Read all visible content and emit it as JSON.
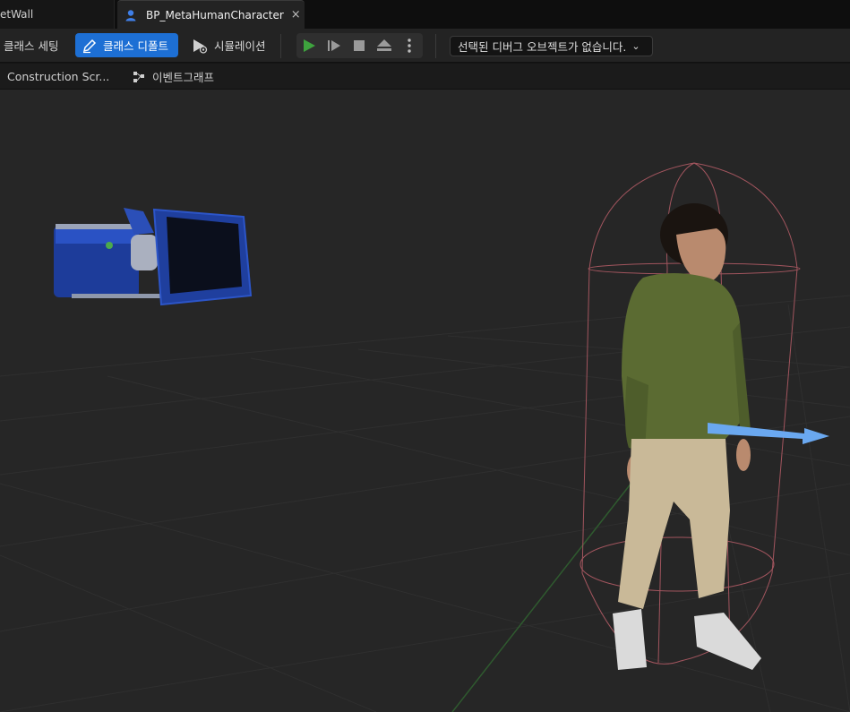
{
  "tabs": {
    "previous": "etWall",
    "active": "BP_MetaHumanCharacter",
    "close_glyph": "×"
  },
  "toolbar": {
    "class_settings": "클래스 세팅",
    "class_defaults": "클래스 디폴트",
    "simulation": "시뮬레이션",
    "debug_object": "선택된 디버그 오브젝트가 없습니다.",
    "debug_chevron": "⌄"
  },
  "graph_tabs": {
    "construction": "Construction Scr...",
    "event_graph": "이벤트그래프"
  },
  "icons": {
    "tab": "character-icon",
    "class_defaults": "edit-pencil-icon",
    "simulation": "simulation-play-icon",
    "play": "play-icon",
    "step": "advance-frame-icon",
    "stop": "stop-icon",
    "eject": "eject-icon",
    "more": "more-vertical-icon",
    "event_graph": "graph-nodes-icon"
  },
  "colors": {
    "accent_blue": "#1d6fd4",
    "play_green": "#3ea33e",
    "viewport_bg": "#262626"
  }
}
